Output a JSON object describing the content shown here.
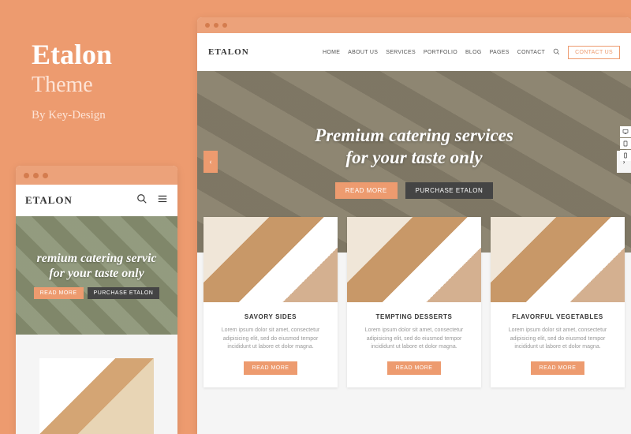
{
  "sidebar": {
    "title": "Etalon",
    "subtitle": "Theme",
    "author": "By Key-Design"
  },
  "mobile": {
    "logo": "ETALON",
    "hero_line1": "remium catering servic",
    "hero_line2": "for your taste only",
    "btn_read": "READ MORE",
    "btn_purchase": "PURCHASE ETALON"
  },
  "desktop": {
    "logo": "ETALON",
    "nav": {
      "home": "HOME",
      "about": "ABOUT US",
      "services": "SERVICES",
      "portfolio": "PORTFOLIO",
      "blog": "BLOG",
      "pages": "PAGES",
      "contact": "CONTACT",
      "cta": "CONTACT US"
    },
    "hero_line1": "Premium catering services",
    "hero_line2": "for your taste only",
    "btn_read": "READ MORE",
    "btn_purchase": "PURCHASE ETALON",
    "cards": [
      {
        "title": "SAVORY SIDES",
        "text": "Lorem ipsum dolor sit amet, consectetur adipisicing elit, sed do eiusmod tempor incididunt ut labore et dolor magna.",
        "btn": "READ MORE"
      },
      {
        "title": "TEMPTING DESSERTS",
        "text": "Lorem ipsum dolor sit amet, consectetur adipisicing elit, sed do eiusmod tempor incididunt ut labore et dolor magna.",
        "btn": "READ MORE"
      },
      {
        "title": "FLAVORFUL VEGETABLES",
        "text": "Lorem ipsum dolor sit amet, consectetur adipisicing elit, sed do eiusmod tempor incididunt ut labore et dolor magna.",
        "btn": "READ MORE"
      }
    ]
  }
}
